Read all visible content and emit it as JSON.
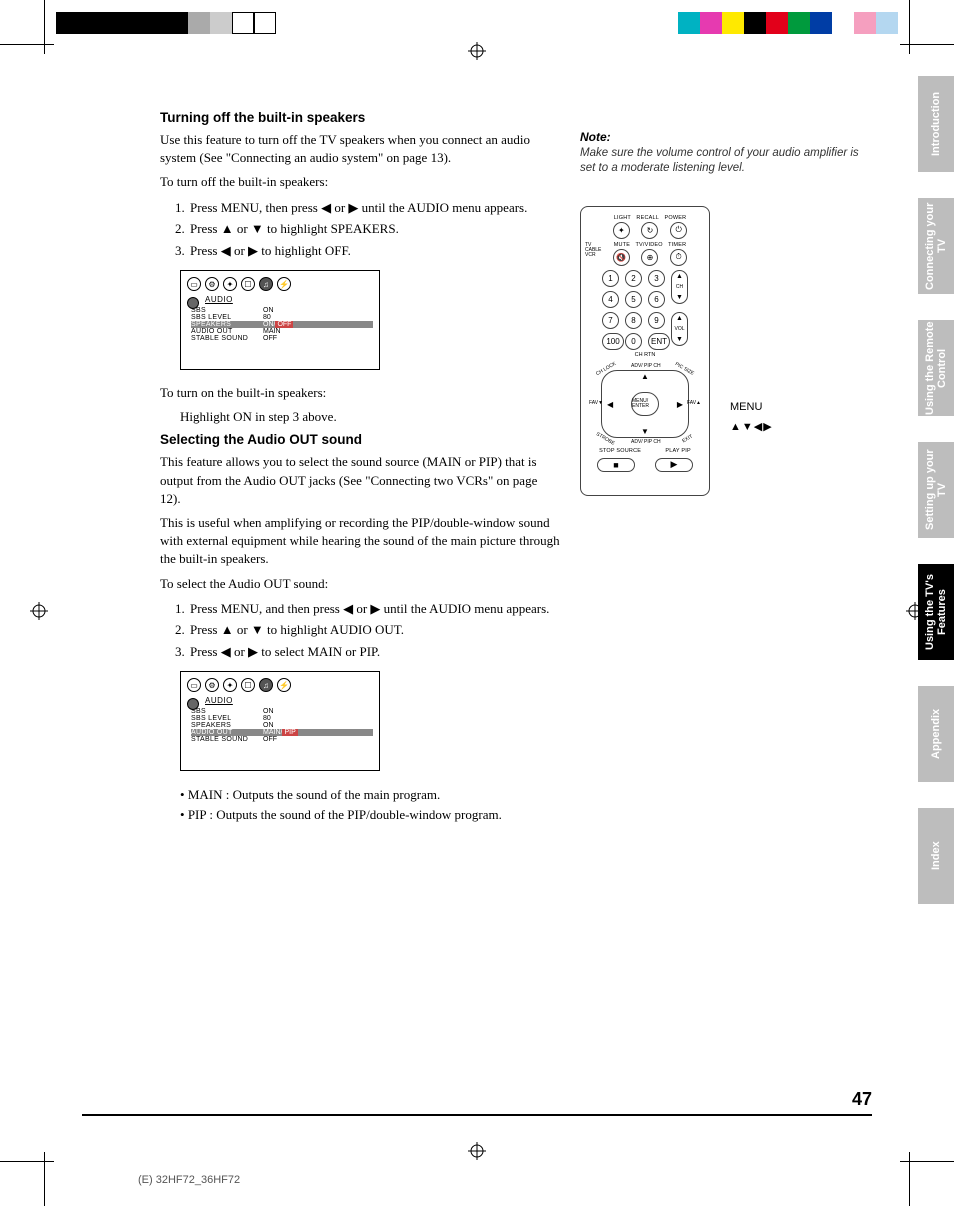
{
  "document": {
    "page_number": "47",
    "footer_code": "(E) 32HF72_36HF72"
  },
  "tabs": [
    "Introduction",
    "Connecting your TV",
    "Using the Remote Control",
    "Setting up your TV",
    "Using the TV's Features",
    "Appendix",
    "Index"
  ],
  "section1": {
    "heading": "Turning off the built-in speakers",
    "intro": "Use this feature to turn off the TV speakers when you connect an audio system (See \"Connecting an audio system\" on page 13).",
    "lead": "To turn off the built-in speakers:",
    "steps": [
      "Press MENU, then press ◀ or ▶ until the AUDIO menu appears.",
      "Press ▲ or ▼ to highlight SPEAKERS.",
      "Press ◀ or ▶ to highlight OFF."
    ],
    "turn_on_lead": "To turn on the built-in speakers:",
    "turn_on_text": "Highlight ON in step 3 above."
  },
  "osd1": {
    "title": "AUDIO",
    "rows": [
      {
        "k": "SBS",
        "v": "ON"
      },
      {
        "k": "SBS  LEVEL",
        "v": "80"
      },
      {
        "k": "SPEAKERS",
        "v": "ON",
        "highlight_row": true,
        "alt": "OFF",
        "alt_sel": true
      },
      {
        "k": "AUDIO  OUT",
        "v": "MAIN"
      },
      {
        "k": "STABLE  SOUND",
        "v": "OFF"
      }
    ]
  },
  "section2": {
    "heading": "Selecting the Audio OUT sound",
    "intro": "This feature allows you to select the sound source (MAIN or PIP) that is output from the Audio OUT jacks (See \"Connecting two VCRs\" on page 12).",
    "intro2": "This is useful when amplifying or recording the PIP/double-window sound with external equipment while hearing the sound of the main picture through the built-in speakers.",
    "lead": "To select the Audio OUT sound:",
    "steps": [
      "Press MENU, and then press ◀ or ▶ until the AUDIO menu appears.",
      "Press ▲ or ▼ to highlight AUDIO OUT.",
      "Press ◀ or ▶ to select MAIN or PIP."
    ],
    "bullets": [
      "MAIN : Outputs the sound of the main program.",
      "PIP     : Outputs the sound of the PIP/double-window program."
    ]
  },
  "osd2": {
    "title": "AUDIO",
    "rows": [
      {
        "k": "SBS",
        "v": "ON"
      },
      {
        "k": "SBS  LEVEL",
        "v": "80"
      },
      {
        "k": "SPEAKERS",
        "v": "ON"
      },
      {
        "k": "AUDIO  OUT",
        "v": "MAIN",
        "highlight_row": true,
        "alt": "PIP",
        "alt_sel": true
      },
      {
        "k": "STABLE  SOUND",
        "v": "OFF"
      }
    ]
  },
  "note": {
    "heading": "Note:",
    "text": "Make sure the volume control of your audio amplifier is set to a moderate listening level."
  },
  "remote": {
    "top_labels": [
      "LIGHT",
      "RECALL",
      "POWER"
    ],
    "row2_labels": [
      "MUTE",
      "TV/VIDEO",
      "TIMER"
    ],
    "switch": [
      "TV",
      "CABLE",
      "VCR"
    ],
    "numbers": [
      "1",
      "2",
      "3",
      "4",
      "5",
      "6",
      "7",
      "8",
      "9",
      "100",
      "0",
      "ENT"
    ],
    "chrtn": "CH RTN",
    "ch": "CH",
    "vol": "VOL",
    "center": "MENU/\nENTER",
    "adv_top": "ADV/\nPIP CH",
    "adv_bot": "ADV/\nPIP CH",
    "fav_l": "FAV▼",
    "fav_r": "FAV▲",
    "corners": [
      "CH LOCK",
      "PIC SIZE",
      "STROBE",
      "EXIT"
    ],
    "bottom_l": "STOP SOURCE",
    "bottom_r": "PLAY PIP",
    "menu_label": "MENU",
    "arrows_label": "▲▼◀▶"
  },
  "colorbars_left": [
    "#000",
    "#000",
    "#000",
    "#000",
    "#000",
    "#000",
    "#aaa",
    "#ccc",
    "#fff",
    "#fff"
  ],
  "colorbars_right": [
    "#00b2c2",
    "#e63ab0",
    "#ffe900",
    "#000",
    "#e2001a",
    "#009a3d",
    "#003da5",
    "#fff",
    "#f59fbf",
    "#b4d7f0"
  ]
}
